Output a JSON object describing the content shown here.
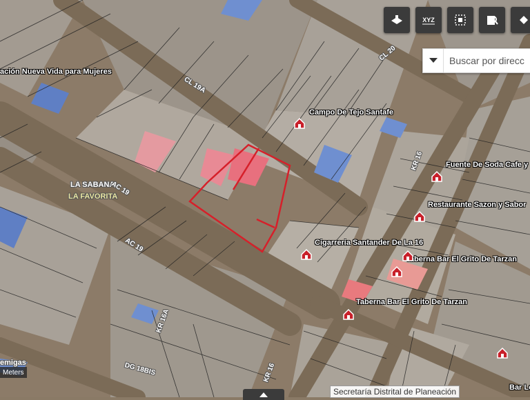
{
  "toolbar": {
    "buttons": [
      {
        "name": "map-layers-icon"
      },
      {
        "name": "xyz-coordinates-icon",
        "label": "XYZ"
      },
      {
        "name": "select-area-icon"
      },
      {
        "name": "search-document-icon"
      },
      {
        "name": "erase-icon"
      }
    ]
  },
  "search": {
    "placeholder": "Buscar por direcc"
  },
  "labels": {
    "nueva_vida": "ación Nueva Vida para Mujeres",
    "campo_tejo": "Campo De Tejo Santafe",
    "fuente_soda": "Fuente De Soda Cafe y I",
    "restaurante": "Restaurante Sazon y Sabor",
    "cigarreria": "Cigarreria Santander De La 16",
    "taberna_1": "Taberna Bar El Grito De Tarzan",
    "taberna_2": "Taberna Bar El Grito De Tarzan",
    "la_sabana": "LA SABANA",
    "la_favorita": "LA FAVORITA",
    "migas": "emigas",
    "bar_lo": "Bar Lo",
    "cl20": "CL 20",
    "cl19a": "CL 19A",
    "ac19_upper": "AC 19",
    "ac19_lower": "AC 19",
    "kr16_upper": "KR 16",
    "kr16a": "KR 16A",
    "kr16_lower": "KR 16",
    "dg18bis": "DG 18BIS"
  },
  "scale": {
    "label": "Meters"
  },
  "attribution": "Secretaría Distrital de Planeación"
}
